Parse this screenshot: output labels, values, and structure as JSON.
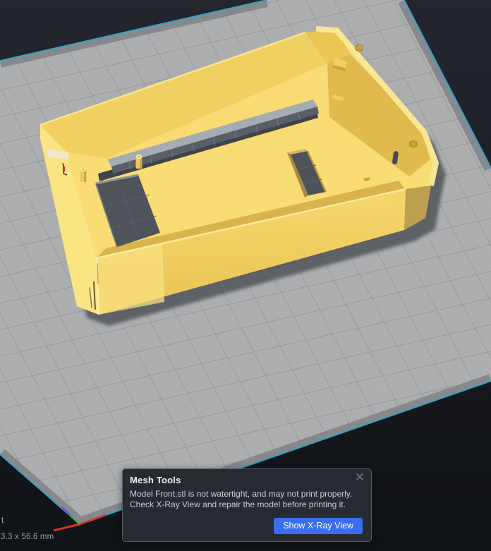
{
  "app": {
    "name": "3D slicer viewport",
    "view": "prepare-3d-view"
  },
  "viewport": {
    "status_fragment": "t",
    "status_dimensions": "3.3 x 56.6 mm",
    "model_file_shown": "Front.stl"
  },
  "dialog": {
    "title": "Mesh Tools",
    "message_line1": "Model Front.stl is not watertight, and may not print properly.",
    "message_line2": "Check X-Ray View and repair the model before printing it.",
    "close_icon": "✕",
    "button_label": "Show X-Ray View"
  },
  "colors": {
    "accent_blue": "#3a6df0",
    "model_yellow": "#f9dc73",
    "model_wall_shadow": "#e0ba4c",
    "plate_gray": "#adaeb0",
    "plate_grid_major": "#919396",
    "plate_edge_band": "#84878b",
    "plate_outline_teal": "#2ea3c6",
    "axis_red": "#d8312b",
    "axis_green": "#3fae4a",
    "axis_blue": "#5a57e0",
    "dialog_bg": "#262a31",
    "background_dark": "#14161b",
    "cutout_dark": "#4f545a"
  }
}
